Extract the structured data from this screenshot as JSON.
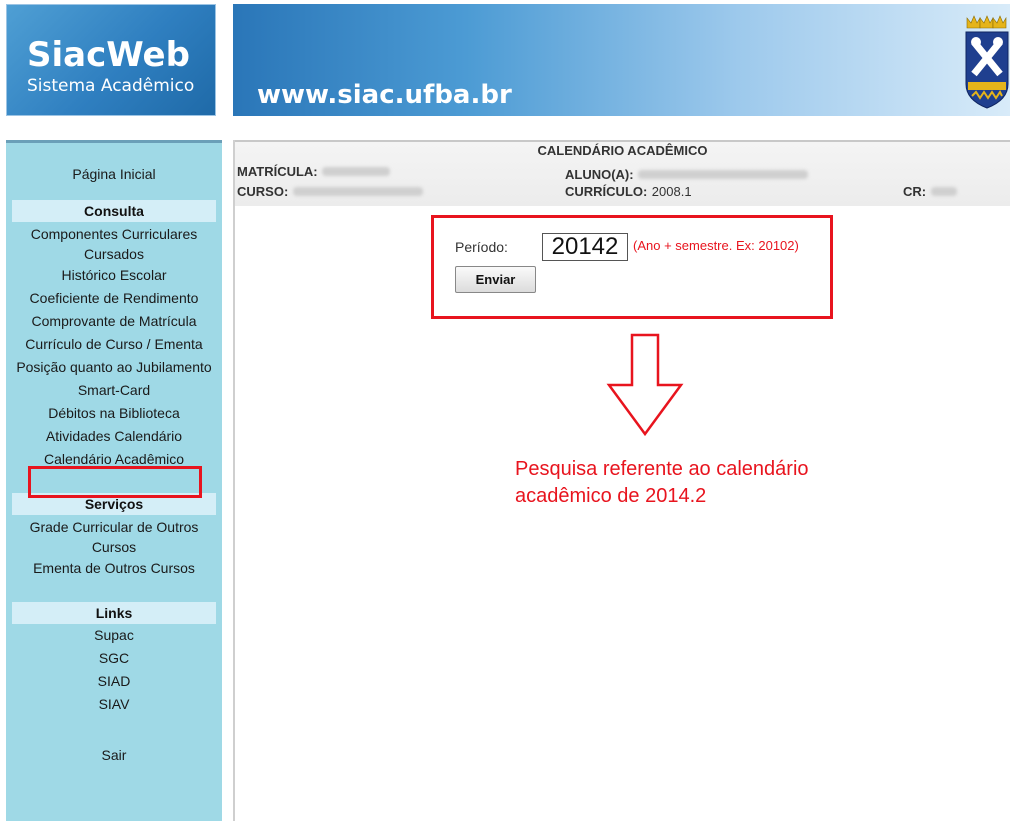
{
  "header": {
    "logo_title": "SiacWeb",
    "logo_subtitle": "Sistema Acadêmico",
    "url": "www.siac.ufba.br",
    "crest_icon": "ufba-crest-icon"
  },
  "sidebar": {
    "home": "Página Inicial",
    "consulta": {
      "heading": "Consulta",
      "items": [
        "Componentes Curriculares Cursados",
        "Histórico Escolar",
        "Coeficiente de Rendimento",
        "Comprovante de Matrícula",
        "Currículo de Curso / Ementa",
        "Posição quanto ao Jubilamento",
        "Smart-Card",
        "Débitos na Biblioteca",
        "Atividades Calendário",
        "Calendário Acadêmico"
      ]
    },
    "servicos": {
      "heading": "Serviços",
      "items": [
        "Grade Curricular de Outros Cursos",
        "Ementa de Outros Cursos"
      ]
    },
    "links": {
      "heading": "Links",
      "items": [
        "Supac",
        "SGC",
        "SIAD",
        "SIAV"
      ]
    },
    "logout": "Sair"
  },
  "page": {
    "title": "CALENDÁRIO ACADÊMICO",
    "matricula_label": "MATRÍCULA:",
    "aluno_label": "ALUNO(A):",
    "curso_label": "CURSO:",
    "curriculo_label": "CURRÍCULO:",
    "curriculo_value": "2008.1",
    "cr_label": "CR:"
  },
  "form": {
    "periodo_label": "Período:",
    "periodo_value": "20142",
    "hint": "(Ano + semestre. Ex: 20102)",
    "submit_label": "Enviar"
  },
  "annotation": {
    "text": "Pesquisa referente ao calendário acadêmico de 2014.2",
    "color": "#e8141e"
  },
  "colors": {
    "sidebar_bg": "#9fd9e6",
    "sidebar_heading_bg": "#d4eef7",
    "header_blue": "#2f7fc0",
    "highlight_red": "#e8141e"
  }
}
